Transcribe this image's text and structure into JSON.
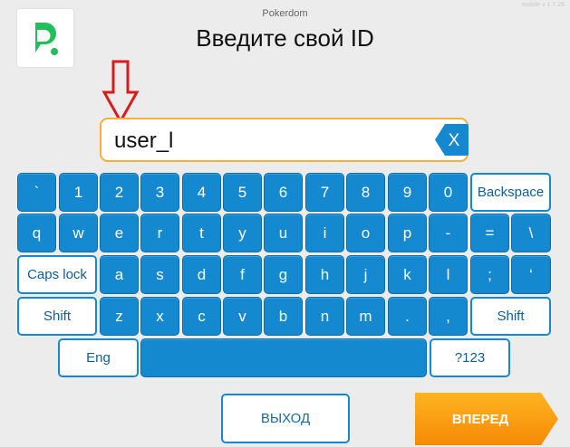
{
  "version": "mobile v 1.7.26",
  "header": {
    "app_name": "Pokerdom",
    "title": "Введите свой ID"
  },
  "input": {
    "value": "user_l",
    "clear_label": "X"
  },
  "keyboard": {
    "row1": [
      "`",
      "1",
      "2",
      "3",
      "4",
      "5",
      "6",
      "7",
      "8",
      "9",
      "0"
    ],
    "backspace": "Backspace",
    "row2": [
      "q",
      "w",
      "e",
      "r",
      "t",
      "y",
      "u",
      "i",
      "o",
      "p",
      "-",
      "=",
      "\\"
    ],
    "caps_lock": "Caps lock",
    "row3": [
      "a",
      "s",
      "d",
      "f",
      "g",
      "h",
      "j",
      "k",
      "l",
      ";",
      "‘"
    ],
    "shift": "Shift",
    "row4": [
      "z",
      "x",
      "c",
      "v",
      "b",
      "n",
      "m",
      ".",
      ","
    ],
    "lang": "Eng",
    "numbers": "?123"
  },
  "buttons": {
    "exit": "ВЫХОД",
    "next": "ВПЕРЕД"
  },
  "colors": {
    "key_blue": "#1589cf",
    "accent_orange": "#f7a20f",
    "logo_green": "#1fbf5a",
    "arrow_red": "#d81b1b"
  },
  "icons": {
    "logo": "pokerdom-logo-icon",
    "arrow": "down-arrow-icon",
    "clear": "clear-x-icon"
  }
}
